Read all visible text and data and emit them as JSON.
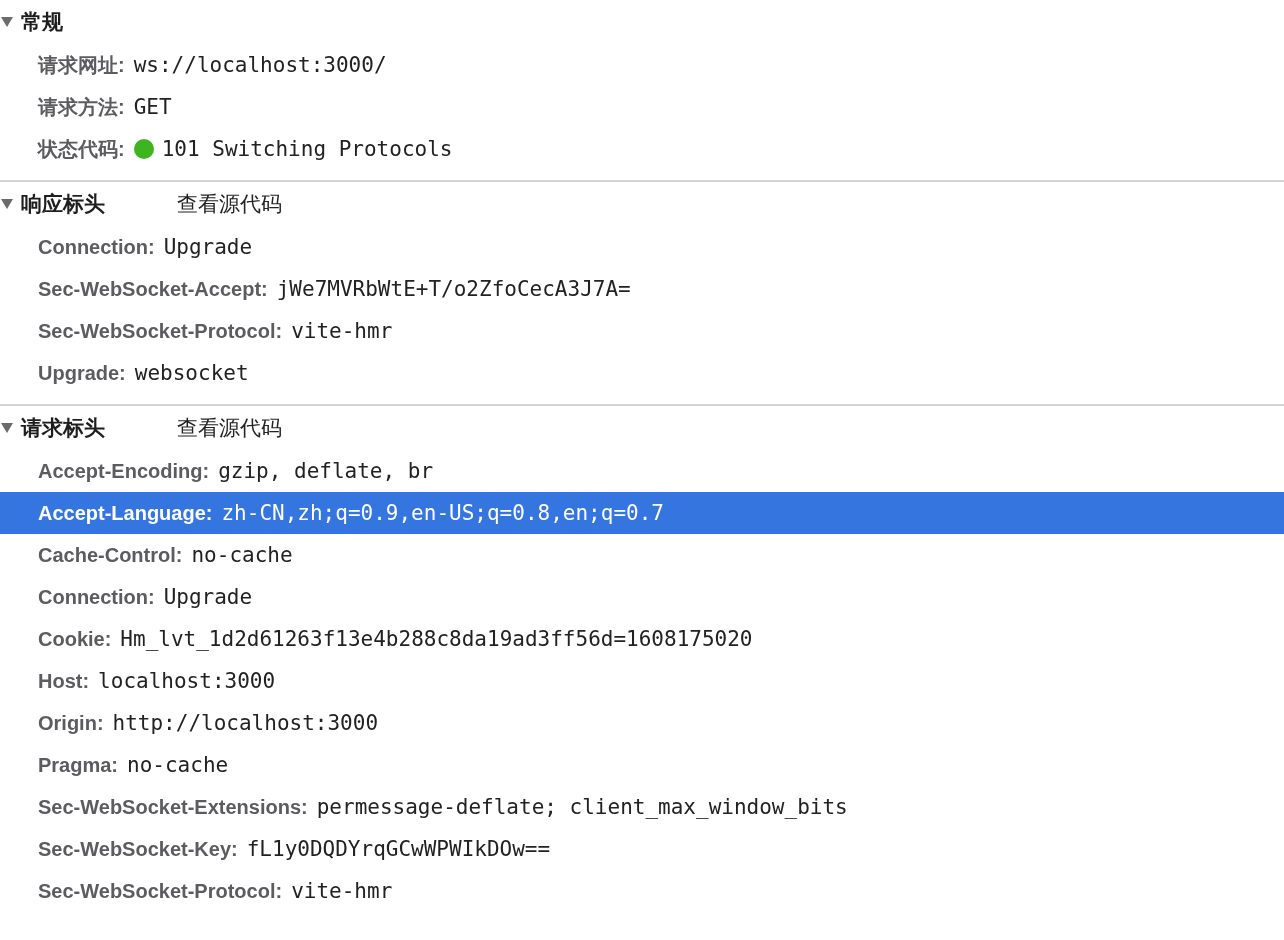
{
  "sections": [
    {
      "title": "常规",
      "expanded": true,
      "rows": [
        {
          "name": "请求网址:",
          "value": "ws://localhost:3000/",
          "selected": false
        },
        {
          "name": "请求方法:",
          "value": "GET",
          "selected": false
        },
        {
          "name": "状态代码:",
          "value": "101 Switching Protocols",
          "selected": false,
          "color": "#3cb521"
        }
      ]
    },
    {
      "title": "响应标头",
      "expanded": true,
      "link": "查看源代码",
      "rows": [
        {
          "name": "Connection:",
          "value": "Upgrade",
          "selected": false
        },
        {
          "name": "Sec-WebSocket-Accept:",
          "value": "jWe7MVRbWtE+T/o2ZfoCecA3J7A=",
          "selected": false
        },
        {
          "name": "Sec-WebSocket-Protocol:",
          "value": "vite-hmr",
          "selected": false
        },
        {
          "name": "Upgrade:",
          "value": "websocket",
          "selected": false
        }
      ]
    },
    {
      "title": "请求标头",
      "expanded": true,
      "link": "查看源代码",
      "rows": [
        {
          "name": "Accept-Encoding:",
          "value": "gzip, deflate, br",
          "selected": false
        },
        {
          "name": "Accept-Language:",
          "value": "zh-CN,zh;q=0.9,en-US;q=0.8,en;q=0.7",
          "selected": true
        },
        {
          "name": "Cache-Control:",
          "value": "no-cache",
          "selected": false
        },
        {
          "name": "Connection:",
          "value": "Upgrade",
          "selected": false
        },
        {
          "name": "Cookie:",
          "value": "Hm_lvt_1d2d61263f13e4b288c8da19ad3ff56d=1608175020",
          "selected": false
        },
        {
          "name": "Host:",
          "value": "localhost:3000",
          "selected": false
        },
        {
          "name": "Origin:",
          "value": "http://localhost:3000",
          "selected": false
        },
        {
          "name": "Pragma:",
          "value": "no-cache",
          "selected": false
        },
        {
          "name": "Sec-WebSocket-Extensions:",
          "value": "permessage-deflate; client_max_window_bits",
          "selected": false
        },
        {
          "name": "Sec-WebSocket-Key:",
          "value": "fL1y0DQDYrqGCwWPWIkDOw==",
          "selected": false
        },
        {
          "name": "Sec-WebSocket-Protocol:",
          "value": "vite-hmr",
          "selected": false
        }
      ]
    }
  ]
}
